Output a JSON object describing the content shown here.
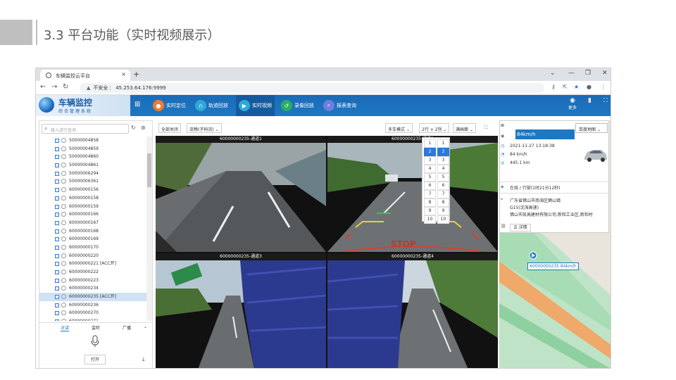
{
  "slide": {
    "title": "3.3 平台功能（实时视频展示）"
  },
  "browser": {
    "tab_title": "车辆监控云平台",
    "security": "不安全",
    "url": "45.253.64.176:9999"
  },
  "app": {
    "logo_title": "车辆监控",
    "logo_subtitle": "综合管理系统",
    "menu": [
      {
        "label": "实时定位",
        "color": "#f07d2d"
      },
      {
        "label": "轨迹回放",
        "color": "#2fa8d8"
      },
      {
        "label": "实时视频",
        "color": "#2fa8d8"
      },
      {
        "label": "录像回放",
        "color": "#27ae60"
      },
      {
        "label": "报表查询",
        "color": "#6c7fe0"
      }
    ],
    "more_label": "更多"
  },
  "left_panel": {
    "search_placeholder": "输入进行查询",
    "vehicles": [
      "50000004858",
      "50000004859",
      "50000004860",
      "50000004861",
      "50000006294",
      "50000006361",
      "60000000156",
      "60000000158",
      "60000000159",
      "60000000166",
      "60000000167",
      "60000000168",
      "60000000169",
      "60000000170",
      "60000000220",
      "60000000221 [ACC开]",
      "60000000222",
      "60000000223",
      "60000000234",
      "60000000235 [ACC开]",
      "60000000236",
      "60000000270",
      "60000000271"
    ],
    "selected_index": 19,
    "tabs": [
      "对讲",
      "监听",
      "广播"
    ],
    "open_label": "打开"
  },
  "toolbar": {
    "close_all": "全部关闭",
    "stream": "流畅(子码流)",
    "mode": "多车模式",
    "layout": "2行 × 2列",
    "fill": "满画面"
  },
  "videos": [
    {
      "label": "60000000235-通道1"
    },
    {
      "label": "60000000235-通道2"
    },
    {
      "label": "60000000235-通道3"
    },
    {
      "label": "60000000235-通道4"
    }
  ],
  "grid_popup": {
    "rows": [
      "1",
      "2",
      "3",
      "4",
      "5",
      "6",
      "7",
      "8",
      "9",
      "10"
    ],
    "cols": [
      "1",
      "2",
      "3",
      "4",
      "5",
      "6",
      "7",
      "8",
      "9",
      "10"
    ],
    "selected_row": 1,
    "selected_col": 1
  },
  "right_panel": {
    "map_type": "百度地图",
    "speed_header": "84km/h",
    "time": "2021-11-27 13:18:38",
    "speed": "84 km/h",
    "mileage": "445.1 km",
    "status": "在线 / 行驶(1时21分12秒)",
    "address_lines": [
      "广东省佛山市南海区狮山镇",
      "G15(沈海高速)",
      "佛山市凯高建材有限公司,新和工业区,新和村"
    ],
    "detail_label": "详情",
    "marker_label": "60000000235 84km/h"
  }
}
